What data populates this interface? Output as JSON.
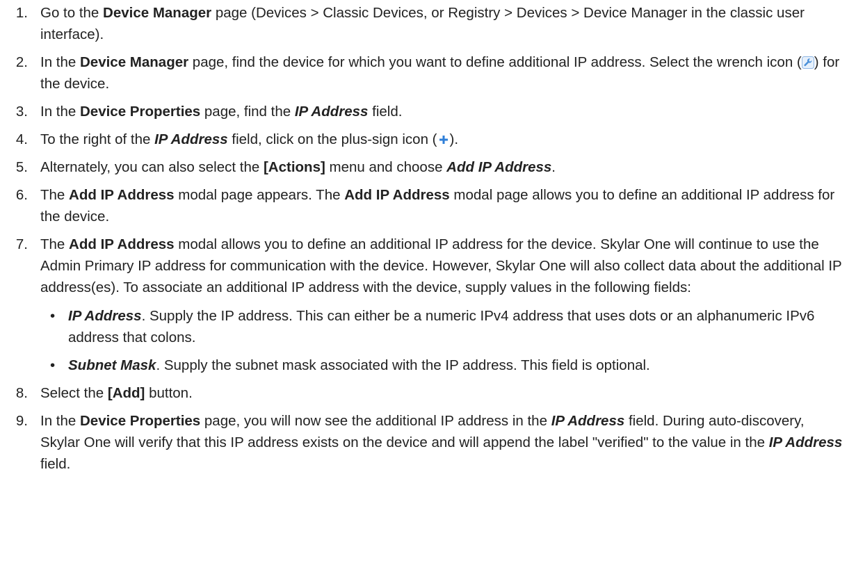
{
  "steps": [
    {
      "num": "1.",
      "t1": "Go to the ",
      "b1": "Device Manager",
      "t2": " page (Devices > Classic Devices, or Registry > Devices > Device Manager in the classic user interface)."
    },
    {
      "num": "2.",
      "t1": "In the ",
      "b1": "Device Manager",
      "t2": " page, find the device for which you want to define additional IP address. Select the wrench icon (",
      "icon": "wrench-icon",
      "t3": ") for the device."
    },
    {
      "num": "3.",
      "t1": "In the ",
      "b1": "Device Properties",
      "t2": " page, find the ",
      "i1": "IP Address",
      "t3": " field."
    },
    {
      "num": "4.",
      "t1": "To the right of the ",
      "i1": "IP Address",
      "t2": " field, click on the plus-sign icon (",
      "icon": "plus-icon",
      "t3": ")."
    },
    {
      "num": "5.",
      "t1": "Alternately, you can also select the ",
      "b1": "[Actions]",
      "t2": " menu and choose ",
      "i1": "Add IP Address",
      "t3": "."
    },
    {
      "num": "6.",
      "t1": "The ",
      "b1": "Add IP Address",
      "t2": " modal page appears. The ",
      "b2": "Add IP Address",
      "t3": " modal page allows you to define an additional IP address for the device."
    },
    {
      "num": "7.",
      "t1": "The ",
      "b1": "Add IP Address",
      "t2": " modal allows you to define an additional IP address for the device. Skylar One will continue to use the Admin Primary IP address for communication with the device. However, Skylar One will also collect data about the additional IP address(es). To associate an additional IP address with the device, supply values in the following fields:",
      "fields": [
        {
          "bullet": "•",
          "name": "IP Address",
          "text": ". Supply the IP address. This can either be a numeric IPv4 address that uses dots or an alphanumeric IPv6 address that colons."
        },
        {
          "bullet": "•",
          "name": "Subnet Mask",
          "text": ". Supply the subnet mask associated with the IP address. This field is optional."
        }
      ]
    },
    {
      "num": "8.",
      "t1": "Select the ",
      "b1": "[Add]",
      "t2": " button."
    },
    {
      "num": "9.",
      "t1": "In the ",
      "b1": "Device Properties",
      "t2": " page, you will now see the additional IP address in the ",
      "i1": "IP Address",
      "t3": " field. During auto-discovery, Skylar One will verify that this IP address exists on the device and will append the label \"verified\" to the value in the ",
      "i2": "IP Address",
      "t4": " field."
    }
  ],
  "colors": {
    "text": "#222222",
    "wrench_icon": "#4a90d9",
    "plus_icon": "#2f7fd8"
  }
}
